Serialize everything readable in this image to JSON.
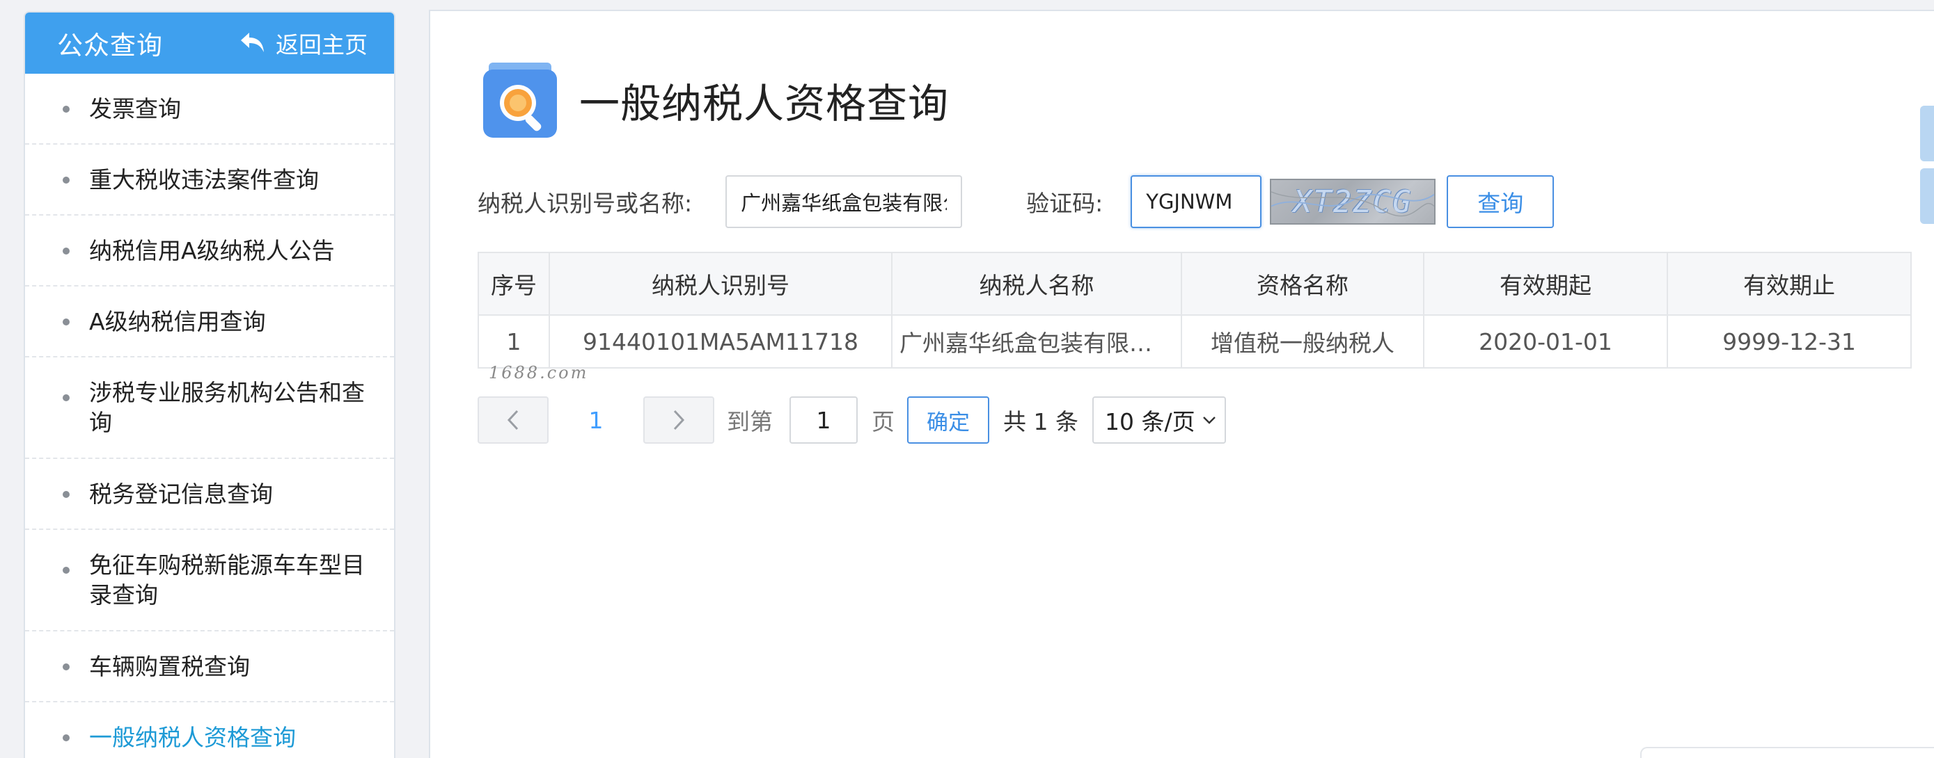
{
  "sidebar": {
    "title": "公众查询",
    "back_label": "返回主页",
    "items": [
      {
        "label": "发票查询"
      },
      {
        "label": "重大税收违法案件查询"
      },
      {
        "label": "纳税信用A级纳税人公告"
      },
      {
        "label": "A级纳税信用查询"
      },
      {
        "label": "涉税专业服务机构公告和查询"
      },
      {
        "label": "税务登记信息查询"
      },
      {
        "label": "免征车购税新能源车车型目录查询"
      },
      {
        "label": "车辆购置税查询"
      },
      {
        "label": "一般纳税人资格查询"
      }
    ]
  },
  "page": {
    "title": "一般纳税人资格查询"
  },
  "form": {
    "taxpayer_label": "纳税人识别号或名称:",
    "taxpayer_value": "广州嘉华纸盒包装有限公司",
    "captcha_label": "验证码:",
    "captcha_value": "YGJNWM",
    "captcha_image_text": "XT2ZCG",
    "query_label": "查询"
  },
  "table": {
    "headers": [
      "序号",
      "纳税人识别号",
      "纳税人名称",
      "资格名称",
      "有效期起",
      "有效期止"
    ],
    "rows": [
      [
        "1",
        "91440101MA5AM11718",
        "广州嘉华纸盒包装有限公司",
        "增值税一般纳税人",
        "2020-01-01",
        "9999-12-31"
      ]
    ]
  },
  "watermark": "1688.com",
  "pagination": {
    "current_page": "1",
    "goto_label": "到第",
    "goto_value": "1",
    "page_unit": "页",
    "confirm_label": "确定",
    "total_text": "共 1 条",
    "page_size": "10 条/页"
  },
  "colors": {
    "accent": "#3fa0ee",
    "active_link": "#1d9ad6",
    "button_border": "#4a90e2"
  },
  "icons": {
    "back": "reply-arrow-icon",
    "header": "search-document-icon",
    "prev": "chevron-left-icon",
    "next": "chevron-right-icon",
    "dropdown": "chevron-down-icon"
  }
}
